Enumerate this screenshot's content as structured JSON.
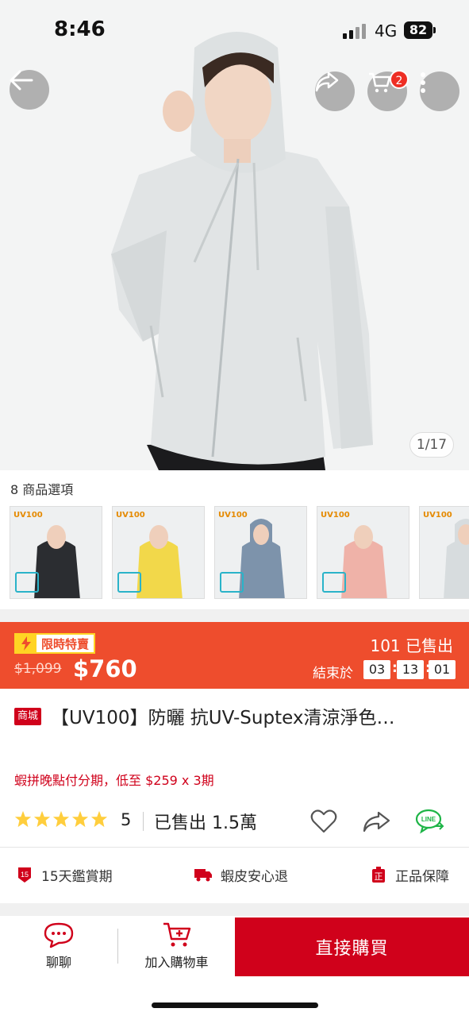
{
  "status_bar": {
    "time": "8:46",
    "network": "4G",
    "battery": "82"
  },
  "header": {
    "back_icon": "arrow-left-icon",
    "share_icon": "share-icon",
    "cart_icon": "cart-icon",
    "cart_badge": "2",
    "more_icon": "more-vertical-icon"
  },
  "gallery": {
    "counter": "1/17",
    "main_color": "#dfe3e4"
  },
  "options": {
    "title": "8 商品選項",
    "thumbnails": [
      {
        "brand": "UV100",
        "color": "#2b2d31"
      },
      {
        "brand": "UV100",
        "color": "#f2d84a"
      },
      {
        "brand": "UV100",
        "color": "#7d93ab"
      },
      {
        "brand": "UV100",
        "color": "#efb2a8"
      },
      {
        "brand": "UV100",
        "color": "#d7dcde"
      }
    ]
  },
  "flash_sale": {
    "label": "限時特賣",
    "original_price": "$1,099",
    "price": "$760",
    "sold": "101 已售出",
    "ends_label": "結束於",
    "countdown": {
      "h": "03",
      "m": "13",
      "s": "01"
    },
    "bg_color": "#ee4d2d"
  },
  "product": {
    "mall_tag": "商城",
    "title": "【UV100】防曬 抗UV-Suptex清涼淨色…",
    "installment": "蝦拼晚點付分期，低至 $259 x 3期",
    "rating": "5",
    "sold_total": "已售出 1.5萬",
    "rating_stars": 5
  },
  "guarantees": [
    {
      "icon": "appraisal-icon",
      "label": "15天鑑賞期"
    },
    {
      "icon": "return-truck-icon",
      "label": "蝦皮安心退"
    },
    {
      "icon": "authentic-icon",
      "label": "正品保障"
    }
  ],
  "bottom_bar": {
    "chat_label": "聊聊",
    "cart_label": "加入購物車",
    "buy_label": "直接購買"
  }
}
